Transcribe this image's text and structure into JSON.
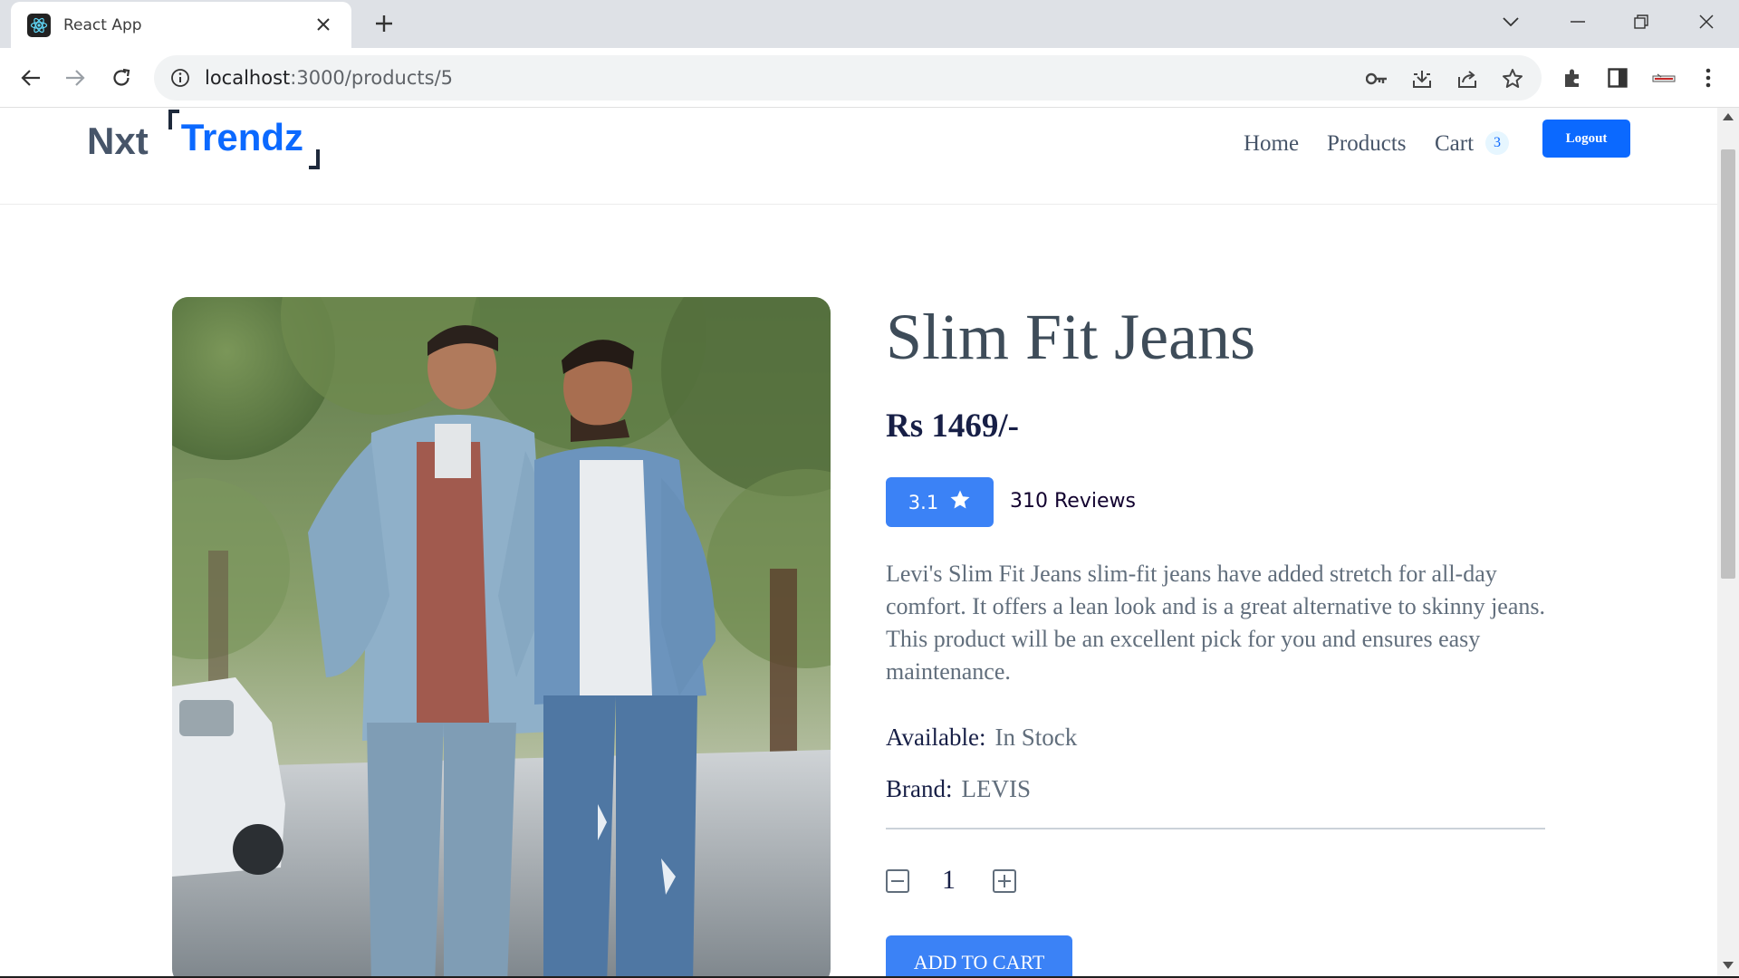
{
  "browser": {
    "tab_title": "React App",
    "url_host": "localhost",
    "url_path": ":3000/products/5"
  },
  "header": {
    "logo_part1": "Nxt",
    "logo_part2": "Trendz",
    "nav": {
      "home": "Home",
      "products": "Products",
      "cart": "Cart",
      "cart_count": "3",
      "logout": "Logout"
    }
  },
  "product": {
    "title": "Slim Fit Jeans",
    "price": "Rs 1469/-",
    "rating": "3.1",
    "reviews": "310 Reviews",
    "description": "Levi's Slim Fit Jeans slim-fit jeans have added stretch for all-day comfort. It offers a lean look and is a great alternative to skinny jeans. This product will be an excellent pick for you and ensures easy maintenance.",
    "available_label": "Available:",
    "available_value": "In Stock",
    "brand_label": "Brand:",
    "brand_value": "LEVIS",
    "quantity": "1",
    "add_to_cart": "ADD TO CART"
  },
  "colors": {
    "brand_blue": "#0b69ff",
    "rating_blue": "#3b82f6",
    "heading": "#3e4c59"
  },
  "icons": {
    "favicon": "react-logo-icon",
    "rating": "star-icon",
    "decrement": "minus-square-icon",
    "increment": "plus-square-icon"
  }
}
